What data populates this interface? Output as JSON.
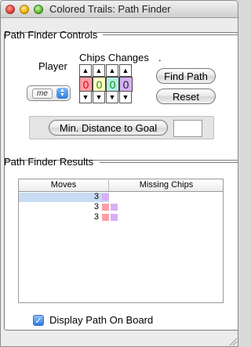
{
  "window": {
    "title": "Colored Trails: Path Finder"
  },
  "controls": {
    "group_title": "Path Finder Controls",
    "player_label": "Player",
    "player_value": "me",
    "chips_changes_label": "Chips Changes",
    "chips_changes_dot": ".",
    "chips": [
      {
        "value": "0",
        "color": "#ff9fa6",
        "text_color": "#d8001b"
      },
      {
        "value": "0",
        "color": "#ffffc0",
        "text_color": "#1a8f1a"
      },
      {
        "value": "0",
        "color": "#b0f0e0",
        "text_color": "#1a8f1a"
      },
      {
        "value": "0",
        "color": "#d6b0f5",
        "text_color": "#222222"
      }
    ],
    "up_arrow": "▲",
    "down_arrow": "▼",
    "find_path_label": "Find Path",
    "reset_label": "Reset",
    "min_distance_label": "Min. Distance to Goal",
    "min_distance_value": ""
  },
  "results": {
    "group_title": "Path Finder Results",
    "columns": [
      "Moves",
      "Missing Chips"
    ],
    "rows": [
      {
        "moves": "3",
        "missing_chips": [
          "#d6b0f5"
        ],
        "selected": true
      },
      {
        "moves": "3",
        "missing_chips": [
          "#ff9fa6",
          "#d6b0f5"
        ],
        "selected": false
      },
      {
        "moves": "3",
        "missing_chips": [
          "#ff9fa6",
          "#d6b0f5"
        ],
        "selected": false
      }
    ],
    "display_path_label": "Display Path On Board",
    "display_path_checked": true,
    "check_mark": "✓"
  }
}
